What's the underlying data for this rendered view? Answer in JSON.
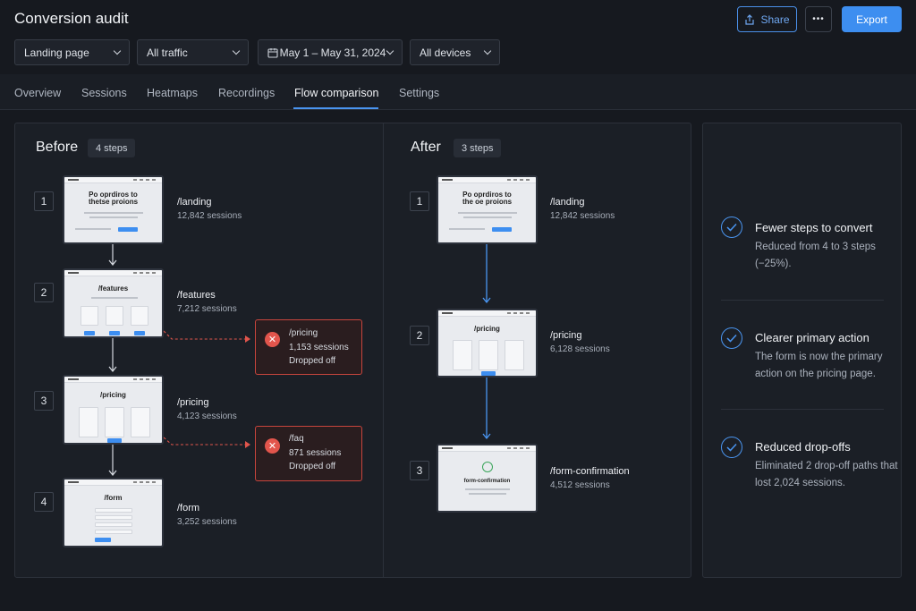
{
  "header": {
    "title": "Conversion audit",
    "share_label": "Share",
    "more_label": "•••",
    "export_label": "Export"
  },
  "filters": {
    "page": "Landing page",
    "traffic": "All traffic",
    "date_range": "May 1 – May 31, 2024",
    "devices": "All devices"
  },
  "tabs": [
    {
      "label": "Overview"
    },
    {
      "label": "Sessions"
    },
    {
      "label": "Heatmaps"
    },
    {
      "label": "Recordings"
    },
    {
      "label": "Flow comparison",
      "active": true
    },
    {
      "label": "Settings"
    }
  ],
  "before": {
    "title": "Before",
    "steps_label": "4 steps",
    "steps": [
      {
        "num": "1",
        "page": "/landing",
        "sessions": "12,842 sessions",
        "thumb_heading": "Po oprdiros to\nthetse proions"
      },
      {
        "num": "2",
        "page": "/features",
        "sessions": "7,212 sessions",
        "thumb_heading": "/features"
      },
      {
        "num": "3",
        "page": "/pricing",
        "sessions": "4,123 sessions",
        "thumb_heading": "/pricing"
      },
      {
        "num": "4",
        "page": "/form",
        "sessions": "3,252 sessions",
        "thumb_heading": "/form"
      }
    ],
    "dropoffs": [
      {
        "page": "/pricing",
        "sessions": "1,153 sessions",
        "status": "Dropped off"
      },
      {
        "page": "/faq",
        "sessions": "871 sessions",
        "status": "Dropped off"
      }
    ]
  },
  "after": {
    "title": "After",
    "steps_label": "3 steps",
    "steps": [
      {
        "num": "1",
        "page": "/landing",
        "sessions": "12,842 sessions",
        "thumb_heading": "Po oprdiros to\nthe oe proions"
      },
      {
        "num": "2",
        "page": "/pricing",
        "sessions": "6,128 sessions",
        "thumb_heading": "/pricing"
      },
      {
        "num": "3",
        "page": "/form-confirmation",
        "sessions": "4,512 sessions",
        "thumb_heading": "form-confirmation"
      }
    ]
  },
  "benefits": [
    {
      "title": "Fewer steps to convert",
      "desc": "Reduced from 4 to 3 steps (−25%)."
    },
    {
      "title": "Clearer primary action",
      "desc": "The form is now the primary action on the pricing page."
    },
    {
      "title": "Reduced drop-offs",
      "desc": "Eliminated 2 drop-off paths that lost 2,024 sessions."
    }
  ],
  "colors": {
    "accent": "#3d8ef0",
    "danger": "#e2554c",
    "background": "#16191f"
  }
}
